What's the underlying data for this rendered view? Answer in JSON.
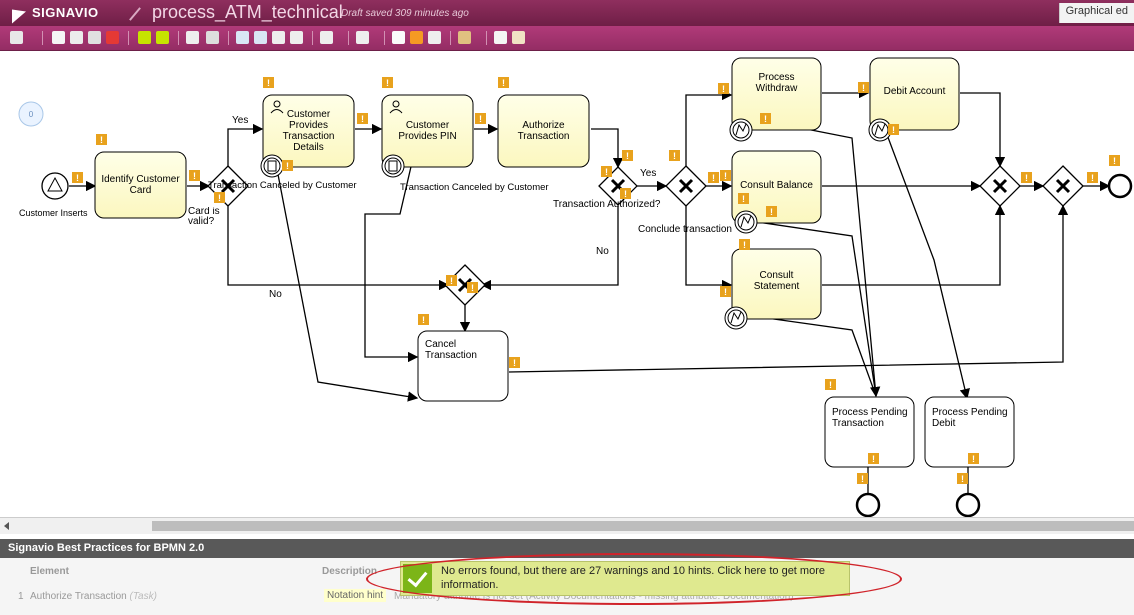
{
  "app": {
    "brand": "SIGNAVIO",
    "doc_title": "process_ATM_technical",
    "draft_status": "Draft saved 309 minutes ago",
    "graphical": "Graphical ed"
  },
  "toolbar": {
    "icons": [
      "print-icon",
      "cut-icon",
      "copy-icon",
      "paste-icon",
      "delete-icon",
      "undo-icon",
      "redo-icon",
      "align-icon",
      "layout-icon",
      "zoom-in-icon",
      "zoom-out-icon",
      "zoom-fit-icon",
      "zoom-page-icon",
      "format-icon",
      "text-icon",
      "comment-icon",
      "chart-icon",
      "attachment-icon",
      "users-icon",
      "mail-icon",
      "book-icon"
    ]
  },
  "diagram": {
    "tasks": {
      "identify": "Identify Customer Card",
      "provides_details": "Customer Provides Transaction Details",
      "provides_pin": "Customer Provides PIN",
      "authorize": "Authorize Transaction",
      "withdraw": "Process Withdraw",
      "debit": "Debit Account",
      "consult_balance": "Consult Balance",
      "consult_statement": "Consult Statement",
      "cancel": "Cancel Transaction",
      "pending_transaction": "Process Pending Transaction",
      "pending_debit": "Process Pending Debit"
    },
    "labels": {
      "start": "Customer Inserts",
      "yes1": "Yes",
      "card_valid": "Card is valid?",
      "no1": "No",
      "canceled1": "Transaction Canceled by Customer",
      "canceled2": "Transaction Canceled by Customer",
      "yes2": "Yes",
      "authorized": "Transaction Authorized?",
      "no2": "No",
      "conclude": "Conclude transaction"
    },
    "comment_count": "0",
    "warning_mark": "!"
  },
  "bottom_panel": {
    "title": "Signavio Best Practices for BPMN 2.0",
    "col_element": "Element",
    "col_description": "Description",
    "row_number": "1",
    "row_element": "Authorize Transaction",
    "row_element_type": "(Task)",
    "row_type": "Notation hint",
    "row_desc": "Mandatory attribute is not set (Activity Documentations - missing attribute: Documentation)",
    "toast": "No errors found, but there are 27 warnings and 10 hints. Click here to get more information."
  }
}
